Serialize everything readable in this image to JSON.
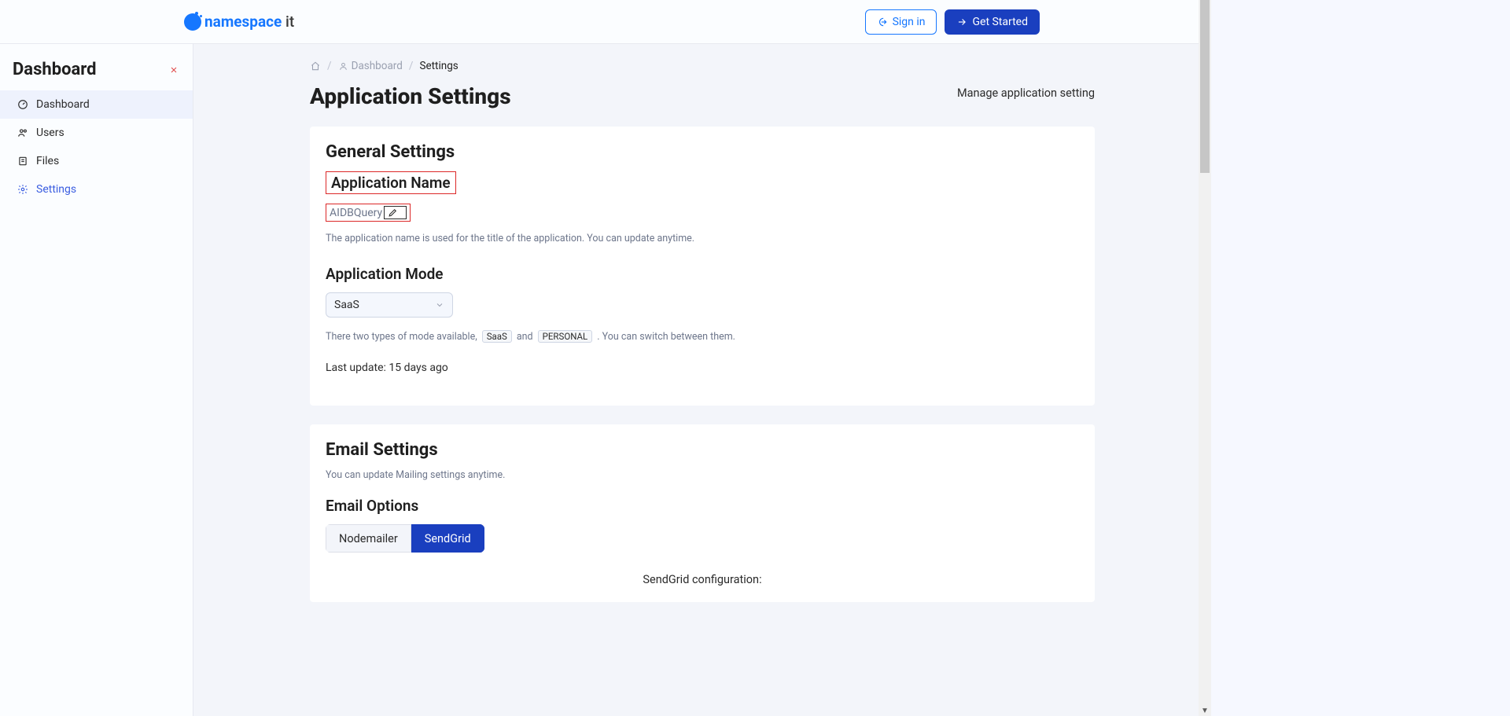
{
  "brand": {
    "name1": "namespace",
    "name2": " it"
  },
  "topbar": {
    "signin_label": "Sign in",
    "get_started_label": "Get Started"
  },
  "sidebar": {
    "title": "Dashboard",
    "items": [
      {
        "label": "Dashboard"
      },
      {
        "label": "Users"
      },
      {
        "label": "Files"
      },
      {
        "label": "Settings"
      }
    ]
  },
  "breadcrumb": {
    "dashboard": "Dashboard",
    "current": "Settings"
  },
  "page": {
    "title": "Application Settings",
    "subtitle": "Manage application setting"
  },
  "general": {
    "heading": "General Settings",
    "app_name_label": "Application Name",
    "app_name_value": "AIDBQuery",
    "app_name_help": "The application name is used for the title of the application. You can update anytime.",
    "mode_label": "Application Mode",
    "mode_value": "SaaS",
    "mode_help_prefix": "There two types of mode available,",
    "mode_tag1": "SaaS",
    "mode_help_and": "and",
    "mode_tag2": "PERSONAL",
    "mode_help_suffix": ". You can switch between them.",
    "last_update": "Last update: 15 days ago"
  },
  "email": {
    "heading": "Email Settings",
    "help": "You can update Mailing settings anytime.",
    "options_label": "Email Options",
    "option1": "Nodemailer",
    "option2": "SendGrid",
    "sendgrid_heading": "SendGrid configuration:"
  }
}
